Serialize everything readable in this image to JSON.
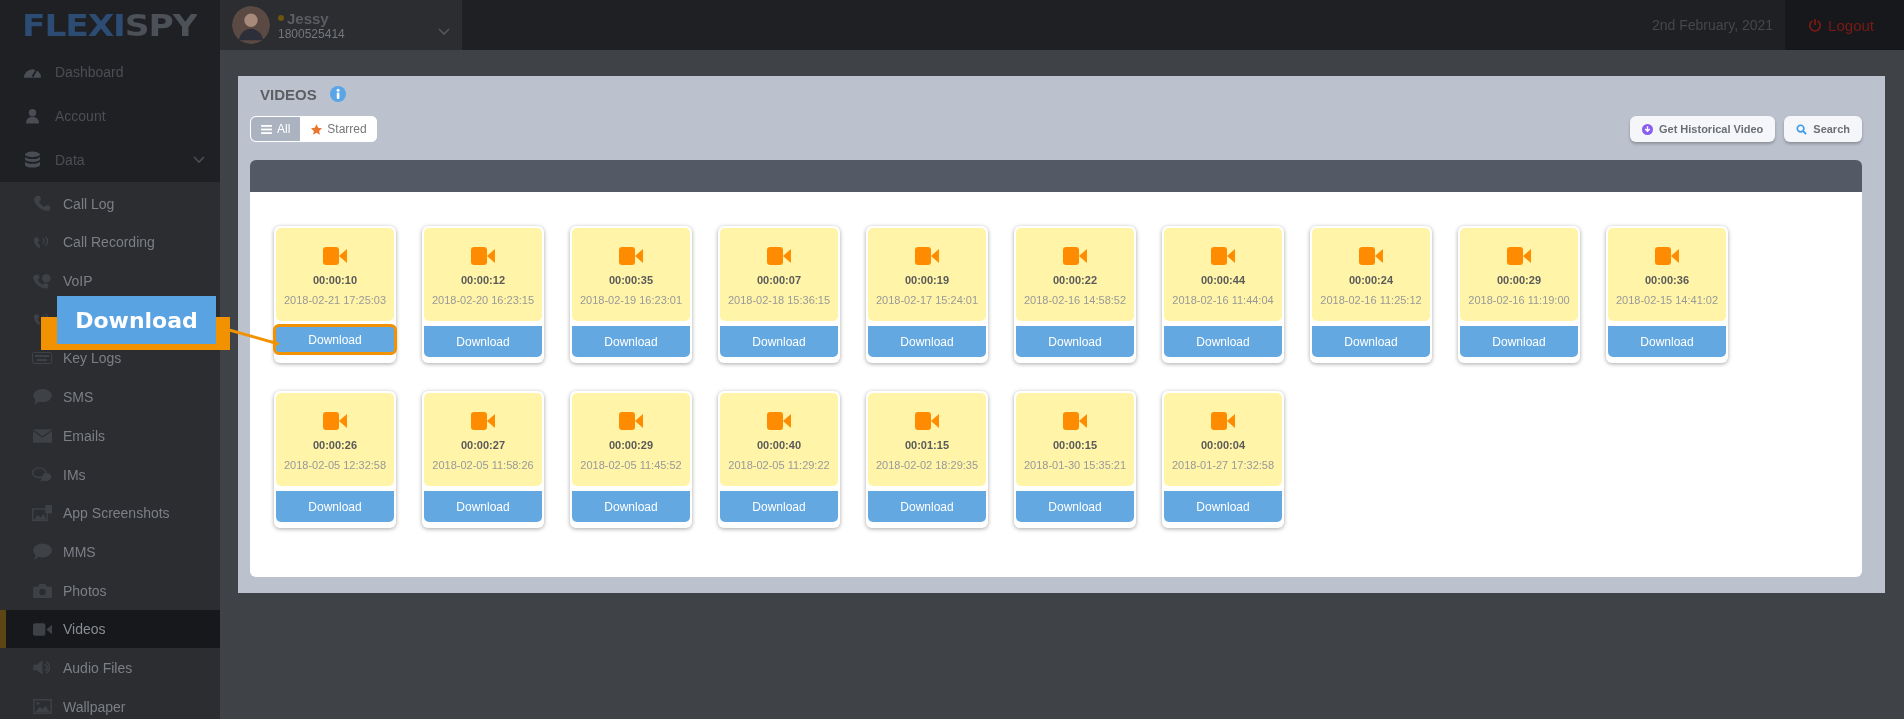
{
  "logo": "FLEXISPY",
  "device": {
    "name": "Jessy",
    "number": "1800525414",
    "online": true
  },
  "date": "2nd February, 2021",
  "logout": "Logout",
  "sidebar": {
    "top_items": [
      {
        "label": "Dashboard"
      },
      {
        "label": "Account"
      },
      {
        "label": "Data",
        "expanded": true
      }
    ],
    "items": [
      {
        "label": "Call Log",
        "selected": false
      },
      {
        "label": "Call Recording",
        "selected": false
      },
      {
        "label": "VoIP",
        "selected": false
      },
      {
        "selected": false
      },
      {
        "label": "Key Logs",
        "selected": false
      },
      {
        "label": "SMS",
        "selected": false
      },
      {
        "label": "Emails",
        "selected": false
      },
      {
        "label": "IMs",
        "selected": false
      },
      {
        "label": "App Screenshots",
        "selected": false
      },
      {
        "label": "MMS",
        "selected": false
      },
      {
        "label": "Photos",
        "selected": false
      },
      {
        "label": "Videos",
        "selected": true
      },
      {
        "label": "Audio Files",
        "selected": false
      },
      {
        "label": "Wallpaper",
        "selected": false
      }
    ]
  },
  "page_title": "VIDEOS",
  "filter_tabs": [
    {
      "label": "All",
      "selected": true
    },
    {
      "label": "Starred",
      "selected": false
    }
  ],
  "actions": [
    "Get Historical Video",
    "Search"
  ],
  "videos": [
    {
      "duration": "00:00:10",
      "timestamp": "2018-02-21 17:25:03",
      "button": "Download",
      "highlighted": true
    },
    {
      "duration": "00:00:12",
      "timestamp": "2018-02-20 16:23:15",
      "button": "Download",
      "highlighted": false
    },
    {
      "duration": "00:00:35",
      "timestamp": "2018-02-19 16:23:01",
      "button": "Download",
      "highlighted": false
    },
    {
      "duration": "00:00:07",
      "timestamp": "2018-02-18 15:36:15",
      "button": "Download",
      "highlighted": false
    },
    {
      "duration": "00:00:19",
      "timestamp": "2018-02-17 15:24:01",
      "button": "Download",
      "highlighted": false
    },
    {
      "duration": "00:00:22",
      "timestamp": "2018-02-16 14:58:52",
      "button": "Download",
      "highlighted": false
    },
    {
      "duration": "00:00:44",
      "timestamp": "2018-02-16 11:44:04",
      "button": "Download",
      "highlighted": false
    },
    {
      "duration": "00:00:24",
      "timestamp": "2018-02-16 11:25:12",
      "button": "Download",
      "highlighted": false
    },
    {
      "duration": "00:00:29",
      "timestamp": "2018-02-16 11:19:00",
      "button": "Download",
      "highlighted": false
    },
    {
      "duration": "00:00:36",
      "timestamp": "2018-02-15 14:41:02",
      "button": "Download",
      "highlighted": false
    },
    {
      "duration": "00:00:26",
      "timestamp": "2018-02-05 12:32:58",
      "button": "Download",
      "highlighted": false
    },
    {
      "duration": "00:00:27",
      "timestamp": "2018-02-05 11:58:26",
      "button": "Download",
      "highlighted": false
    },
    {
      "duration": "00:00:29",
      "timestamp": "2018-02-05 11:45:52",
      "button": "Download",
      "highlighted": false
    },
    {
      "duration": "00:00:40",
      "timestamp": "2018-02-05 11:29:22",
      "button": "Download",
      "highlighted": false
    },
    {
      "duration": "00:01:15",
      "timestamp": "2018-02-02 18:29:35",
      "button": "Download",
      "highlighted": false
    },
    {
      "duration": "00:00:15",
      "timestamp": "2018-01-30 15:35:21",
      "button": "Download",
      "highlighted": false
    },
    {
      "duration": "00:00:04",
      "timestamp": "2018-01-27 17:32:58",
      "button": "Download",
      "highlighted": false
    }
  ],
  "callout": {
    "label": "Download"
  }
}
